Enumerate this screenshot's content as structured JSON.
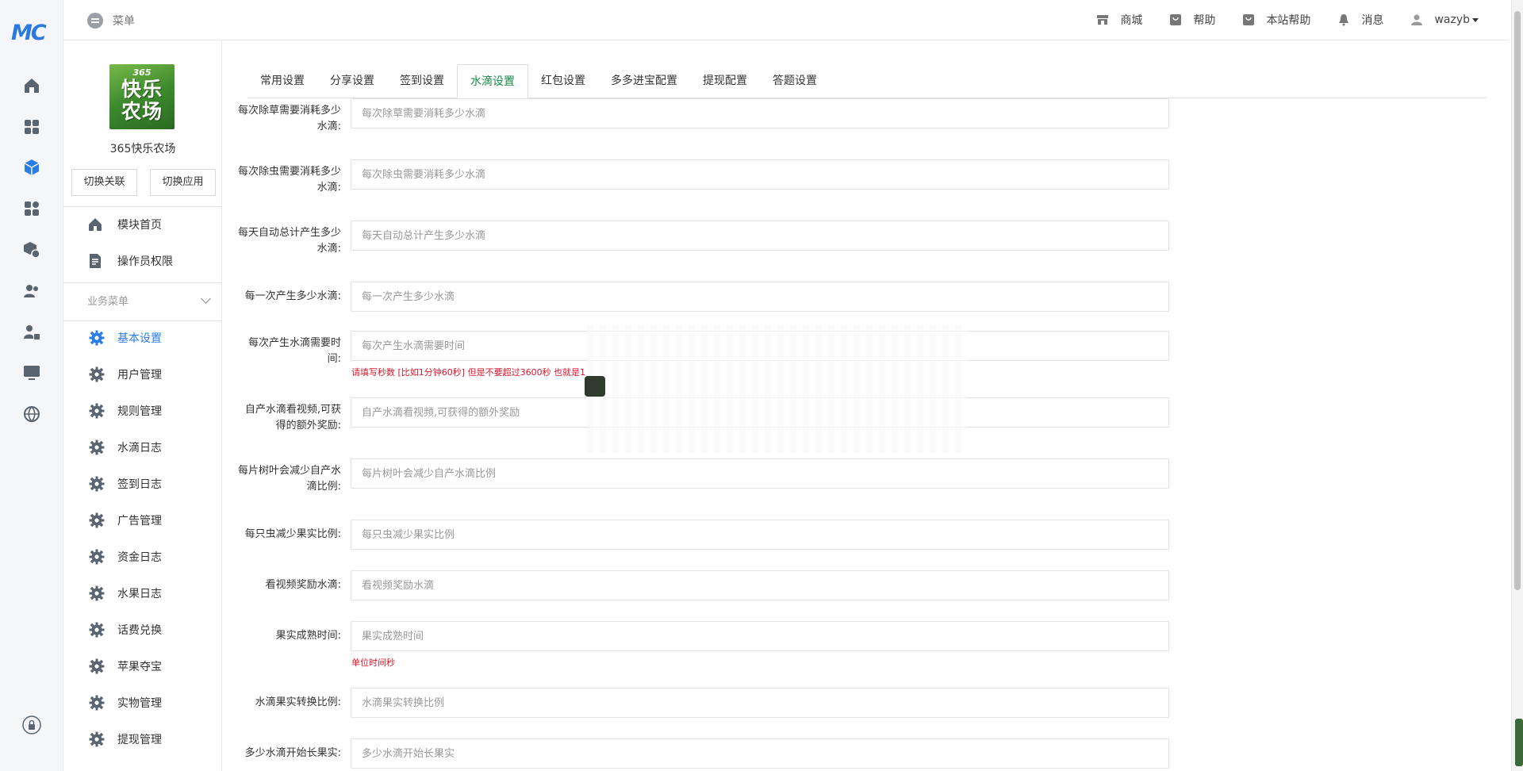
{
  "brand": {
    "logo_text": "MC"
  },
  "topbar": {
    "menu_label": "菜单",
    "links": [
      {
        "label": "商城",
        "icon": "shop-icon"
      },
      {
        "label": "帮助",
        "icon": "help-icon"
      },
      {
        "label": "本站帮助",
        "icon": "site-help-icon"
      },
      {
        "label": "消息",
        "icon": "bell-icon"
      }
    ],
    "user": "wazyb"
  },
  "app": {
    "logo_number": "365",
    "logo_text": "快乐农场",
    "name": "365快乐农场",
    "switch_assoc": "切换关联",
    "switch_app": "切换应用"
  },
  "module_menu": [
    {
      "label": "模块首页",
      "icon": "home-icon"
    },
    {
      "label": "操作员权限",
      "icon": "document-icon"
    }
  ],
  "business_menu": {
    "title": "业务菜单",
    "items": [
      {
        "label": "基本设置",
        "active": true
      },
      {
        "label": "用户管理"
      },
      {
        "label": "规则管理"
      },
      {
        "label": "水滴日志"
      },
      {
        "label": "签到日志"
      },
      {
        "label": "广告管理"
      },
      {
        "label": "资金日志"
      },
      {
        "label": "水果日志"
      },
      {
        "label": "话费兑换"
      },
      {
        "label": "苹果夺宝"
      },
      {
        "label": "实物管理"
      },
      {
        "label": "提现管理"
      }
    ]
  },
  "tabs": [
    "常用设置",
    "分享设置",
    "签到设置",
    "水滴设置",
    "红包设置",
    "多多进宝配置",
    "提现配置",
    "答题设置"
  ],
  "active_tab": "水滴设置",
  "form": {
    "fields": [
      {
        "label": "每次除草需要消耗多少水滴:",
        "placeholder": "每次除草需要消耗多少水滴"
      },
      {
        "label": "每次除虫需要消耗多少水滴:",
        "placeholder": "每次除虫需要消耗多少水滴"
      },
      {
        "label": "每天自动总计产生多少水滴:",
        "placeholder": "每天自动总计产生多少水滴"
      },
      {
        "label": "每一次产生多少水滴:",
        "placeholder": "每一次产生多少水滴"
      },
      {
        "label": "每次产生水滴需要时间:",
        "placeholder": "每次产生水滴需要时间",
        "hint": "请填写秒数 [比如1分钟60秒] 但是不要超过3600秒 也就是1"
      },
      {
        "label": "自产水滴看视频,可获得的额外奖励:",
        "placeholder": "自产水滴看视频,可获得的额外奖励"
      },
      {
        "label": "每片树叶会减少自产水滴比例:",
        "placeholder": "每片树叶会减少自产水滴比例"
      },
      {
        "label": "每只虫减少果实比例:",
        "placeholder": "每只虫减少果实比例"
      },
      {
        "label": "看视频奖励水滴:",
        "placeholder": "看视频奖励水滴"
      },
      {
        "label": "果实成熟时间:",
        "placeholder": "果实成熟时间",
        "hint": "单位时间秒"
      },
      {
        "label": "水滴果实转换比例:",
        "placeholder": "水滴果实转换比例"
      },
      {
        "label": "多少水滴开始长果实:",
        "placeholder": "多少水滴开始长果实"
      }
    ]
  },
  "colors": {
    "accent": "#2b7ce5",
    "active_tab_text": "#1a8a46",
    "hint": "#d9172c"
  }
}
